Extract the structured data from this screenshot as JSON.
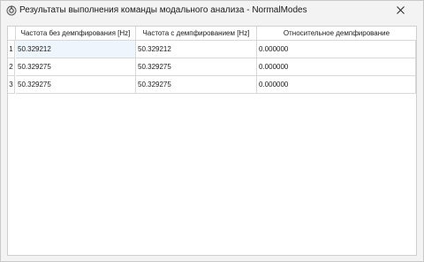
{
  "window": {
    "title": "Результаты выполнения команды модального анализа - NormalModes"
  },
  "table": {
    "columns": [
      "Частота без демпфирования [Hz]",
      "Частота с демпфированием [Hz]",
      "Относительное демпфирование"
    ],
    "rows": [
      {
        "index": "1",
        "cells": [
          "50.329212",
          "50.329212",
          "0.000000"
        ]
      },
      {
        "index": "2",
        "cells": [
          "50.329275",
          "50.329275",
          "0.000000"
        ]
      },
      {
        "index": "3",
        "cells": [
          "50.329275",
          "50.329275",
          "0.000000"
        ]
      }
    ]
  }
}
